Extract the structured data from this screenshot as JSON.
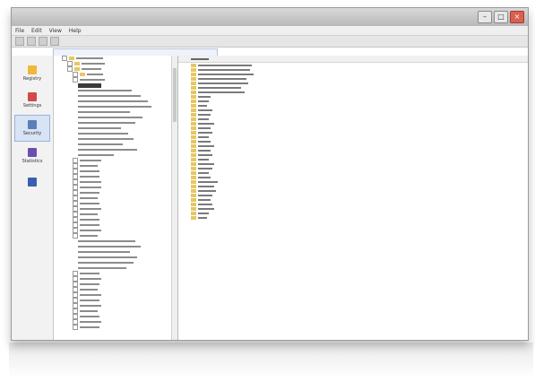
{
  "window": {
    "title": "",
    "controls": {
      "minimize": "",
      "maximize": "",
      "close": ""
    }
  },
  "menu": [
    "File",
    "Edit",
    "View",
    "Help"
  ],
  "address": {
    "path": ""
  },
  "sidebar": {
    "items": [
      {
        "label": "Registry",
        "icon": "folder-icon",
        "color": "#f0b73a"
      },
      {
        "label": "Settings",
        "icon": "settings-icon",
        "color": "#d04a4a"
      },
      {
        "label": "Security",
        "icon": "security-icon",
        "color": "#5a7fb8",
        "active": true
      },
      {
        "label": "Statistics",
        "icon": "statistics-icon",
        "color": "#6a4fb0"
      },
      {
        "label": "",
        "icon": "tool-icon",
        "color": "#3a5fb0"
      }
    ]
  },
  "tree": {
    "rows": [
      {
        "indent": 1,
        "type": "folder",
        "w": 30
      },
      {
        "indent": 2,
        "type": "folder",
        "w": 26
      },
      {
        "indent": 2,
        "type": "folder",
        "w": 22
      },
      {
        "indent": 3,
        "type": "folder",
        "w": 18
      },
      {
        "indent": 3,
        "type": "node",
        "w": 28
      },
      {
        "indent": 4,
        "type": "selected",
        "w": 26
      },
      {
        "indent": 4,
        "type": "item",
        "w": 60
      },
      {
        "indent": 4,
        "type": "item",
        "w": 70
      },
      {
        "indent": 4,
        "type": "item",
        "w": 78
      },
      {
        "indent": 4,
        "type": "item",
        "w": 82
      },
      {
        "indent": 4,
        "type": "item",
        "w": 58
      },
      {
        "indent": 4,
        "type": "item",
        "w": 72
      },
      {
        "indent": 4,
        "type": "item",
        "w": 64
      },
      {
        "indent": 4,
        "type": "item",
        "w": 48
      },
      {
        "indent": 4,
        "type": "item",
        "w": 56
      },
      {
        "indent": 4,
        "type": "item",
        "w": 62
      },
      {
        "indent": 4,
        "type": "item",
        "w": 50
      },
      {
        "indent": 4,
        "type": "item",
        "w": 66
      },
      {
        "indent": 4,
        "type": "item",
        "w": 40
      },
      {
        "indent": 3,
        "type": "node",
        "w": 24
      },
      {
        "indent": 3,
        "type": "node",
        "w": 20
      },
      {
        "indent": 3,
        "type": "node",
        "w": 22
      },
      {
        "indent": 3,
        "type": "node",
        "w": 22
      },
      {
        "indent": 3,
        "type": "node",
        "w": 24
      },
      {
        "indent": 3,
        "type": "node",
        "w": 24
      },
      {
        "indent": 3,
        "type": "node",
        "w": 22
      },
      {
        "indent": 3,
        "type": "node",
        "w": 20
      },
      {
        "indent": 3,
        "type": "node",
        "w": 22
      },
      {
        "indent": 3,
        "type": "node",
        "w": 24
      },
      {
        "indent": 3,
        "type": "node",
        "w": 20
      },
      {
        "indent": 3,
        "type": "node",
        "w": 22
      },
      {
        "indent": 3,
        "type": "node",
        "w": 22
      },
      {
        "indent": 3,
        "type": "node",
        "w": 24
      },
      {
        "indent": 3,
        "type": "node",
        "w": 20
      },
      {
        "indent": 4,
        "type": "item",
        "w": 64
      },
      {
        "indent": 4,
        "type": "item",
        "w": 70
      },
      {
        "indent": 4,
        "type": "item",
        "w": 58
      },
      {
        "indent": 4,
        "type": "item",
        "w": 66
      },
      {
        "indent": 4,
        "type": "item",
        "w": 62
      },
      {
        "indent": 4,
        "type": "item",
        "w": 54
      },
      {
        "indent": 3,
        "type": "node",
        "w": 22
      },
      {
        "indent": 3,
        "type": "node",
        "w": 24
      },
      {
        "indent": 3,
        "type": "node",
        "w": 22
      },
      {
        "indent": 3,
        "type": "node",
        "w": 20
      },
      {
        "indent": 3,
        "type": "node",
        "w": 24
      },
      {
        "indent": 3,
        "type": "node",
        "w": 22
      },
      {
        "indent": 3,
        "type": "node",
        "w": 24
      },
      {
        "indent": 3,
        "type": "node",
        "w": 20
      },
      {
        "indent": 3,
        "type": "node",
        "w": 22
      },
      {
        "indent": 3,
        "type": "node",
        "w": 24
      },
      {
        "indent": 3,
        "type": "node",
        "w": 22
      }
    ]
  },
  "folders": {
    "header": "",
    "rows": [
      {
        "w": 60
      },
      {
        "w": 58
      },
      {
        "w": 62
      },
      {
        "w": 54
      },
      {
        "w": 56
      },
      {
        "w": 48
      },
      {
        "w": 52
      },
      {
        "w": 14
      },
      {
        "w": 12
      },
      {
        "w": 10
      },
      {
        "w": 16
      },
      {
        "w": 14
      },
      {
        "w": 12
      },
      {
        "w": 18
      },
      {
        "w": 14
      },
      {
        "w": 16
      },
      {
        "w": 12
      },
      {
        "w": 14
      },
      {
        "w": 18
      },
      {
        "w": 14
      },
      {
        "w": 16
      },
      {
        "w": 12
      },
      {
        "w": 18
      },
      {
        "w": 16
      },
      {
        "w": 12
      },
      {
        "w": 14
      },
      {
        "w": 22
      },
      {
        "w": 18
      },
      {
        "w": 20
      },
      {
        "w": 16
      },
      {
        "w": 14
      },
      {
        "w": 16
      },
      {
        "w": 18
      },
      {
        "w": 12
      },
      {
        "w": 10
      }
    ]
  }
}
